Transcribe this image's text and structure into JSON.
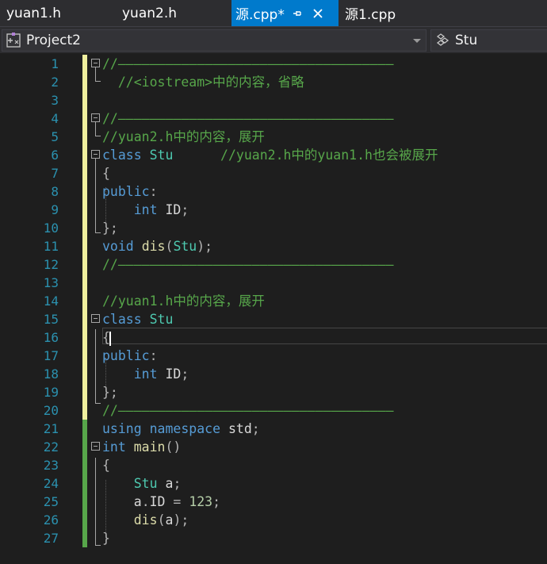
{
  "tabs": [
    {
      "label": "yuan1.h",
      "active": false
    },
    {
      "label": "yuan2.h",
      "active": false
    },
    {
      "label": "源.cpp*",
      "active": true
    },
    {
      "label": "源1.cpp",
      "active": false
    }
  ],
  "nav": {
    "project": "Project2",
    "scope": "Stu"
  },
  "lines": [
    {
      "n": "1"
    },
    {
      "n": "2"
    },
    {
      "n": "3"
    },
    {
      "n": "4"
    },
    {
      "n": "5"
    },
    {
      "n": "6"
    },
    {
      "n": "7"
    },
    {
      "n": "8"
    },
    {
      "n": "9"
    },
    {
      "n": "10"
    },
    {
      "n": "11"
    },
    {
      "n": "12"
    },
    {
      "n": "13"
    },
    {
      "n": "14"
    },
    {
      "n": "15"
    },
    {
      "n": "16"
    },
    {
      "n": "17"
    },
    {
      "n": "18"
    },
    {
      "n": "19"
    },
    {
      "n": "20"
    },
    {
      "n": "21"
    },
    {
      "n": "22"
    },
    {
      "n": "23"
    },
    {
      "n": "24"
    },
    {
      "n": "25"
    },
    {
      "n": "26"
    },
    {
      "n": "27"
    }
  ],
  "code": {
    "l1": "//———————————————————————————————————",
    "l2": "  //<iostream>中的内容，省略",
    "l4": "//———————————————————————————————————",
    "l5": "//yuan2.h中的内容，展开",
    "l6_kw": "class",
    "l6_type": "Stu",
    "l6_comment": "//yuan2.h中的yuan1.h也会被展开",
    "l7": "{",
    "l8_kw": "public",
    "l8_p": ":",
    "l9_kw": "int",
    "l9_id": "ID",
    "l9_p": ";",
    "l10": "};",
    "l11_kw": "void",
    "l11_fn": "dis",
    "l11_p1": "(",
    "l11_type": "Stu",
    "l11_p2": ");",
    "l12": "//———————————————————————————————————",
    "l14": "//yuan1.h中的内容，展开",
    "l15_kw": "class",
    "l15_type": "Stu",
    "l16": "{",
    "l17_kw": "public",
    "l17_p": ":",
    "l18_kw": "int",
    "l18_id": "ID",
    "l18_p": ";",
    "l19": "};",
    "l20": "//———————————————————————————————————",
    "l21_kw1": "using",
    "l21_kw2": "namespace",
    "l21_id": "std",
    "l21_p": ";",
    "l22_kw": "int",
    "l22_fn": "main",
    "l22_p": "()",
    "l23": "{",
    "l24_type": "Stu",
    "l24_id": "a",
    "l24_p": ";",
    "l25_id1": "a",
    "l25_p1": ".",
    "l25_id2": "ID",
    "l25_p2": " = ",
    "l25_num": "123",
    "l25_p3": ";",
    "l26_fn": "dis",
    "l26_p1": "(",
    "l26_id": "a",
    "l26_p2": ");",
    "l27": "}"
  },
  "colors": {
    "tab_active": "#007acc",
    "keyword": "#569cd6",
    "type": "#4ec9b0",
    "comment": "#57a64a",
    "function": "#dcdcaa",
    "line_number": "#2b91af",
    "change_saved": "#57a64a",
    "change_unsaved": "#efef9e"
  }
}
